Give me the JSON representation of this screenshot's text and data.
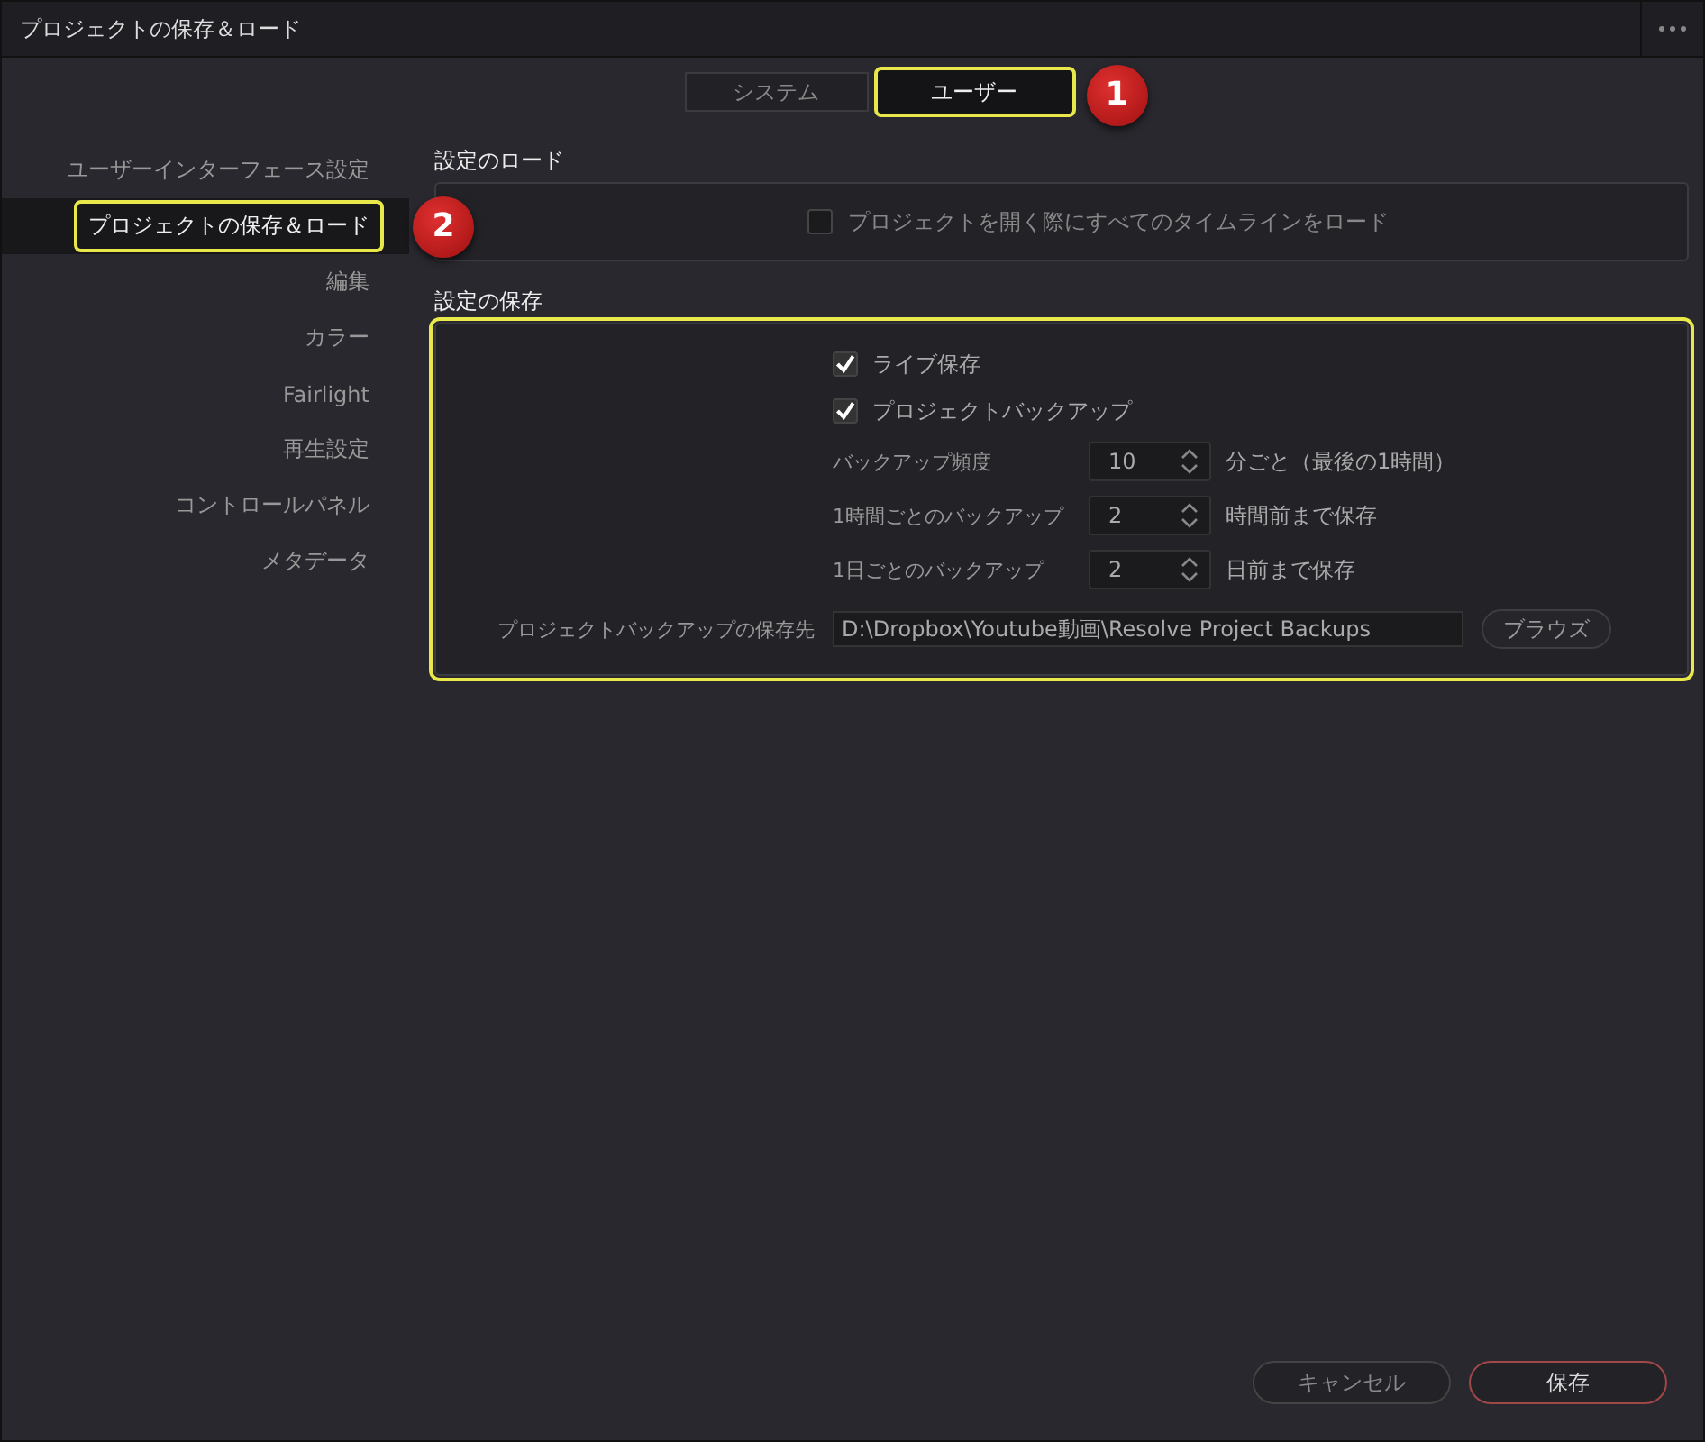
{
  "window": {
    "title": "プロジェクトの保存＆ロード"
  },
  "tabs": [
    {
      "label": "システム",
      "selected": false,
      "highlighted": false
    },
    {
      "label": "ユーザー",
      "selected": true,
      "highlighted": true,
      "callout": "1"
    }
  ],
  "sidebar": {
    "items": [
      {
        "label": "ユーザーインターフェース設定",
        "selected": false,
        "highlighted": false
      },
      {
        "label": "プロジェクトの保存＆ロード",
        "selected": true,
        "highlighted": true,
        "callout": "2"
      },
      {
        "label": "編集",
        "selected": false,
        "highlighted": false
      },
      {
        "label": "カラー",
        "selected": false,
        "highlighted": false
      },
      {
        "label": "Fairlight",
        "selected": false,
        "highlighted": false
      },
      {
        "label": "再生設定",
        "selected": false,
        "highlighted": false
      },
      {
        "label": "コントロールパネル",
        "selected": false,
        "highlighted": false
      },
      {
        "label": "メタデータ",
        "selected": false,
        "highlighted": false
      }
    ]
  },
  "load_section": {
    "heading": "設定のロード",
    "highlighted": false,
    "options": [
      {
        "label": "プロジェクトを開く際にすべてのタイムラインをロード",
        "checked": false
      }
    ]
  },
  "save_section": {
    "heading": "設定の保存",
    "highlighted": true,
    "options": [
      {
        "label": "ライブ保存",
        "checked": true
      },
      {
        "label": "プロジェクトバックアップ",
        "checked": true
      }
    ],
    "spinners": [
      {
        "label": "バックアップ頻度",
        "value": "10",
        "suffix": "分ごと（最後の1時間）"
      },
      {
        "label": "1時間ごとのバックアップ",
        "value": "2",
        "suffix": "時間前まで保存"
      },
      {
        "label": "1日ごとのバックアップ",
        "value": "2",
        "suffix": "日前まで保存"
      }
    ],
    "destination": {
      "label": "プロジェクトバックアップの保存先",
      "value": "D:\\Dropbox\\Youtube動画\\Resolve Project Backups"
    },
    "browse_button": "ブラウズ"
  },
  "footer": {
    "buttons": [
      {
        "label": "キャンセル",
        "kind": "secondary"
      },
      {
        "label": "保存",
        "kind": "primary"
      }
    ]
  }
}
